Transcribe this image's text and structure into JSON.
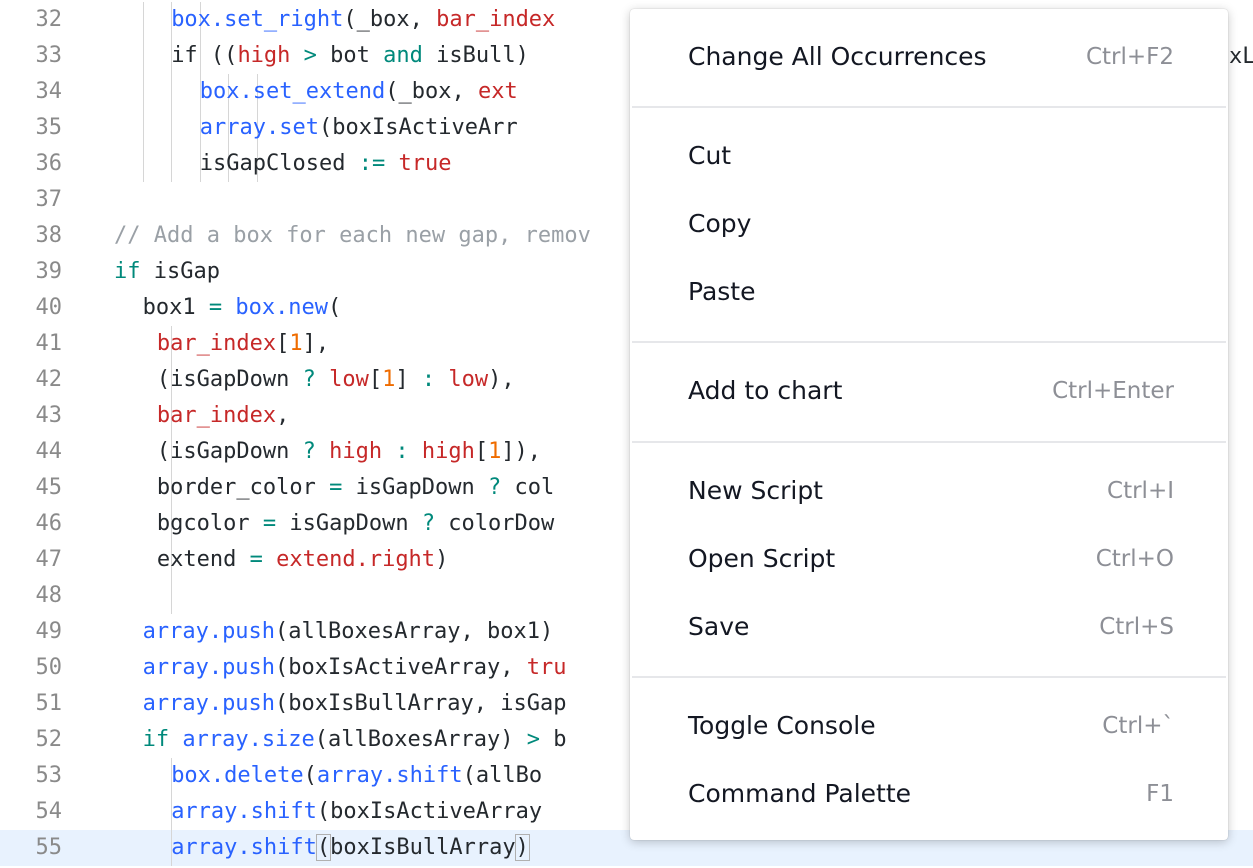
{
  "editor": {
    "lines": [
      {
        "num": "32",
        "indent": 4,
        "guides": [
          1,
          2,
          3
        ],
        "tokens": [
          {
            "t": "box.set_right",
            "c": "fn"
          },
          {
            "t": "(_box, ",
            "c": "plain"
          },
          {
            "t": "bar_index",
            "c": "var"
          }
        ]
      },
      {
        "num": "33",
        "indent": 4,
        "guides": [
          1,
          2,
          3
        ],
        "tokens": [
          {
            "t": "if",
            "c": "plain"
          },
          {
            "t": " ((",
            "c": "plain"
          },
          {
            "t": "high",
            "c": "var"
          },
          {
            "t": " > ",
            "c": "op"
          },
          {
            "t": "bot ",
            "c": "plain"
          },
          {
            "t": "and",
            "c": "kw"
          },
          {
            "t": " isBull)",
            "c": "plain"
          }
        ]
      },
      {
        "num": "34",
        "indent": 6,
        "guides": [
          1,
          2,
          3,
          4,
          5
        ],
        "tokens": [
          {
            "t": "box.set_extend",
            "c": "fn"
          },
          {
            "t": "(_box, ",
            "c": "plain"
          },
          {
            "t": "ext",
            "c": "var"
          }
        ]
      },
      {
        "num": "35",
        "indent": 6,
        "guides": [
          1,
          2,
          3,
          4,
          5
        ],
        "tokens": [
          {
            "t": "array.set",
            "c": "fn"
          },
          {
            "t": "(boxIsActiveArr",
            "c": "plain"
          }
        ]
      },
      {
        "num": "36",
        "indent": 6,
        "guides": [
          1,
          2,
          3,
          4,
          5
        ],
        "tokens": [
          {
            "t": "isGapClosed ",
            "c": "plain"
          },
          {
            "t": ":=",
            "c": "op"
          },
          {
            "t": " ",
            "c": "plain"
          },
          {
            "t": "true",
            "c": "var"
          }
        ]
      },
      {
        "num": "37",
        "indent": 0,
        "guides": [],
        "tokens": []
      },
      {
        "num": "38",
        "indent": 0,
        "guides": [],
        "tokens": [
          {
            "t": "// Add a box for each new gap, remov",
            "c": "cm"
          }
        ]
      },
      {
        "num": "39",
        "indent": 0,
        "guides": [],
        "tokens": [
          {
            "t": "if",
            "c": "kw"
          },
          {
            "t": " isGap",
            "c": "plain"
          }
        ]
      },
      {
        "num": "40",
        "indent": 2,
        "guides": [],
        "tokens": [
          {
            "t": "box1 ",
            "c": "plain"
          },
          {
            "t": "=",
            "c": "op"
          },
          {
            "t": " ",
            "c": "plain"
          },
          {
            "t": "box.new",
            "c": "fn"
          },
          {
            "t": "(",
            "c": "plain"
          }
        ]
      },
      {
        "num": "41",
        "indent": 3,
        "guides": [
          2
        ],
        "tokens": [
          {
            "t": "bar_index",
            "c": "var"
          },
          {
            "t": "[",
            "c": "plain"
          },
          {
            "t": "1",
            "c": "num"
          },
          {
            "t": "],",
            "c": "plain"
          }
        ]
      },
      {
        "num": "42",
        "indent": 3,
        "guides": [
          2
        ],
        "tokens": [
          {
            "t": "(isGapDown ",
            "c": "plain"
          },
          {
            "t": "?",
            "c": "op"
          },
          {
            "t": " ",
            "c": "plain"
          },
          {
            "t": "low",
            "c": "var"
          },
          {
            "t": "[",
            "c": "plain"
          },
          {
            "t": "1",
            "c": "num"
          },
          {
            "t": "] ",
            "c": "plain"
          },
          {
            "t": ":",
            "c": "op"
          },
          {
            "t": " ",
            "c": "plain"
          },
          {
            "t": "low",
            "c": "var"
          },
          {
            "t": "),",
            "c": "plain"
          }
        ]
      },
      {
        "num": "43",
        "indent": 3,
        "guides": [
          2
        ],
        "tokens": [
          {
            "t": "bar_index",
            "c": "var"
          },
          {
            "t": ",",
            "c": "plain"
          }
        ]
      },
      {
        "num": "44",
        "indent": 3,
        "guides": [
          2
        ],
        "tokens": [
          {
            "t": "(isGapDown ",
            "c": "plain"
          },
          {
            "t": "?",
            "c": "op"
          },
          {
            "t": " ",
            "c": "plain"
          },
          {
            "t": "high",
            "c": "var"
          },
          {
            "t": " ",
            "c": "plain"
          },
          {
            "t": ":",
            "c": "op"
          },
          {
            "t": " ",
            "c": "plain"
          },
          {
            "t": "high",
            "c": "var"
          },
          {
            "t": "[",
            "c": "plain"
          },
          {
            "t": "1",
            "c": "num"
          },
          {
            "t": "]),",
            "c": "plain"
          }
        ]
      },
      {
        "num": "45",
        "indent": 3,
        "guides": [
          2
        ],
        "tokens": [
          {
            "t": "border_color ",
            "c": "plain"
          },
          {
            "t": "=",
            "c": "op"
          },
          {
            "t": " isGapDown ",
            "c": "plain"
          },
          {
            "t": "?",
            "c": "op"
          },
          {
            "t": " col",
            "c": "plain"
          }
        ]
      },
      {
        "num": "46",
        "indent": 3,
        "guides": [
          2
        ],
        "tokens": [
          {
            "t": "bgcolor ",
            "c": "plain"
          },
          {
            "t": "=",
            "c": "op"
          },
          {
            "t": " isGapDown ",
            "c": "plain"
          },
          {
            "t": "?",
            "c": "op"
          },
          {
            "t": " colorDow",
            "c": "plain"
          }
        ]
      },
      {
        "num": "47",
        "indent": 3,
        "guides": [
          2
        ],
        "tokens": [
          {
            "t": "extend ",
            "c": "plain"
          },
          {
            "t": "=",
            "c": "op"
          },
          {
            "t": " ",
            "c": "plain"
          },
          {
            "t": "extend.right",
            "c": "var"
          },
          {
            "t": ")",
            "c": "plain"
          }
        ]
      },
      {
        "num": "48",
        "indent": 0,
        "guides": [
          2
        ],
        "tokens": []
      },
      {
        "num": "49",
        "indent": 2,
        "guides": [],
        "tokens": [
          {
            "t": "array.push",
            "c": "fn"
          },
          {
            "t": "(allBoxesArray, box1)",
            "c": "plain"
          }
        ]
      },
      {
        "num": "50",
        "indent": 2,
        "guides": [],
        "tokens": [
          {
            "t": "array.push",
            "c": "fn"
          },
          {
            "t": "(boxIsActiveArray, ",
            "c": "plain"
          },
          {
            "t": "tru",
            "c": "var"
          }
        ]
      },
      {
        "num": "51",
        "indent": 2,
        "guides": [],
        "tokens": [
          {
            "t": "array.push",
            "c": "fn"
          },
          {
            "t": "(boxIsBullArray, isGap",
            "c": "plain"
          }
        ]
      },
      {
        "num": "52",
        "indent": 2,
        "guides": [],
        "tokens": [
          {
            "t": "if",
            "c": "kw"
          },
          {
            "t": " ",
            "c": "plain"
          },
          {
            "t": "array.size",
            "c": "fn"
          },
          {
            "t": "(allBoxesArray) ",
            "c": "plain"
          },
          {
            "t": ">",
            "c": "op"
          },
          {
            "t": " b",
            "c": "plain"
          }
        ]
      },
      {
        "num": "53",
        "indent": 4,
        "guides": [
          2
        ],
        "tokens": [
          {
            "t": "box.delete",
            "c": "fn"
          },
          {
            "t": "(",
            "c": "plain"
          },
          {
            "t": "array.shift",
            "c": "fn"
          },
          {
            "t": "(allBo",
            "c": "plain"
          }
        ]
      },
      {
        "num": "54",
        "indent": 4,
        "guides": [
          2
        ],
        "tokens": [
          {
            "t": "array.shift",
            "c": "fn"
          },
          {
            "t": "(boxIsActiveArray",
            "c": "plain"
          }
        ]
      },
      {
        "num": "55",
        "indent": 4,
        "guides": [
          2
        ],
        "current": true,
        "tokens": [
          {
            "t": "array.shift",
            "c": "fn"
          },
          {
            "t": "(",
            "c": "bracket"
          },
          {
            "t": "boxIsBullArray",
            "c": "plain"
          },
          {
            "t": ")",
            "c": "bracket"
          }
        ]
      }
    ],
    "peek_text": "xL"
  },
  "context_menu": {
    "items": [
      {
        "label": "Change All Occurrences",
        "shortcut": "Ctrl+F2",
        "name": "menu-item-change-all-occurrences"
      },
      {
        "label": "Cut",
        "shortcut": "",
        "name": "menu-item-cut"
      },
      {
        "label": "Copy",
        "shortcut": "",
        "name": "menu-item-copy"
      },
      {
        "label": "Paste",
        "shortcut": "",
        "name": "menu-item-paste"
      },
      {
        "label": "Add to chart",
        "shortcut": "Ctrl+Enter",
        "name": "menu-item-add-to-chart"
      },
      {
        "label": "New Script",
        "shortcut": "Ctrl+I",
        "name": "menu-item-new-script"
      },
      {
        "label": "Open Script",
        "shortcut": "Ctrl+O",
        "name": "menu-item-open-script"
      },
      {
        "label": "Save",
        "shortcut": "Ctrl+S",
        "name": "menu-item-save"
      },
      {
        "label": "Toggle Console",
        "shortcut": "Ctrl+`",
        "name": "menu-item-toggle-console"
      },
      {
        "label": "Command Palette",
        "shortcut": "F1",
        "name": "menu-item-command-palette"
      }
    ]
  },
  "colors": {
    "function": "#2962ff",
    "variable": "#c62828",
    "keyword": "#00897b",
    "number": "#ef6c00",
    "comment": "#9aa0a6",
    "current_line": "#e8f2fe"
  }
}
